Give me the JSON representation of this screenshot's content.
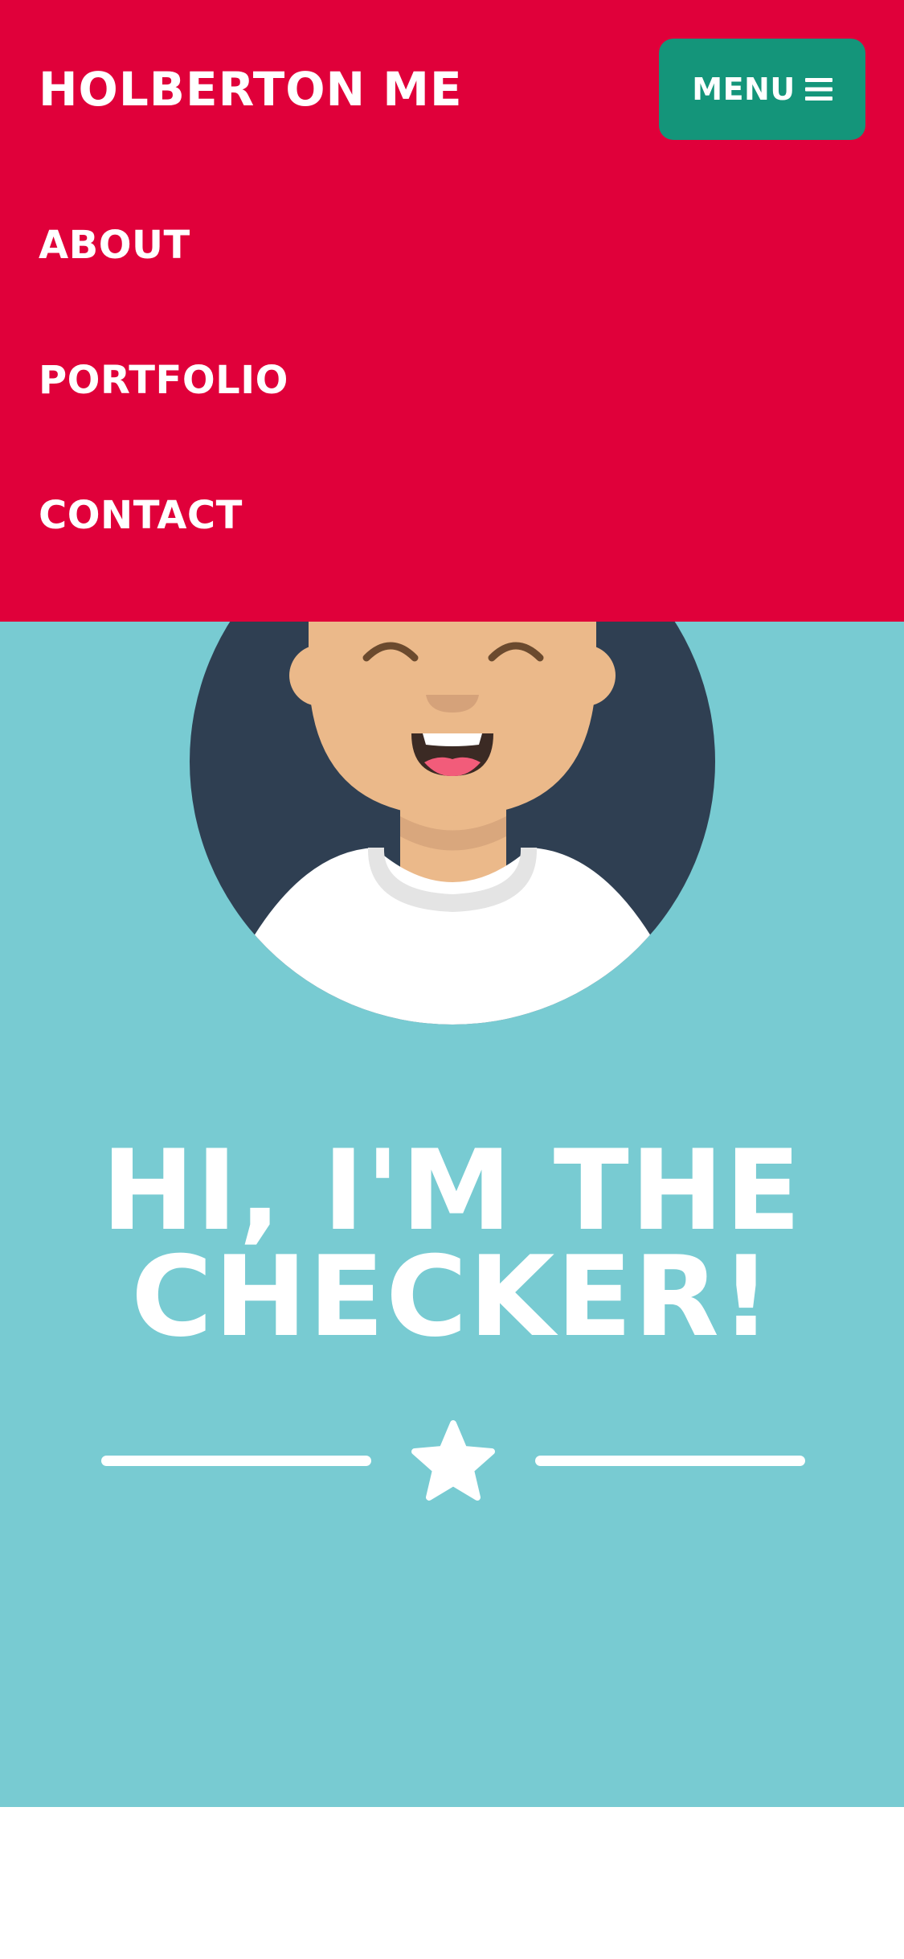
{
  "site": {
    "brand": "HOLBERTON ME"
  },
  "menu": {
    "label": "MENU",
    "icon": "hamburger-icon",
    "background": "#14957A"
  },
  "nav": {
    "background": "#E0003A",
    "items": [
      {
        "label": "ABOUT"
      },
      {
        "label": "PORTFOLIO"
      },
      {
        "label": "CONTACT"
      }
    ]
  },
  "hero": {
    "background": "#78CBD2",
    "avatar_icon": "avatar-illustration",
    "headline_line1": "HI, I'M THE",
    "headline_line2": "CHECKER!",
    "divider_icon": "star-icon"
  }
}
